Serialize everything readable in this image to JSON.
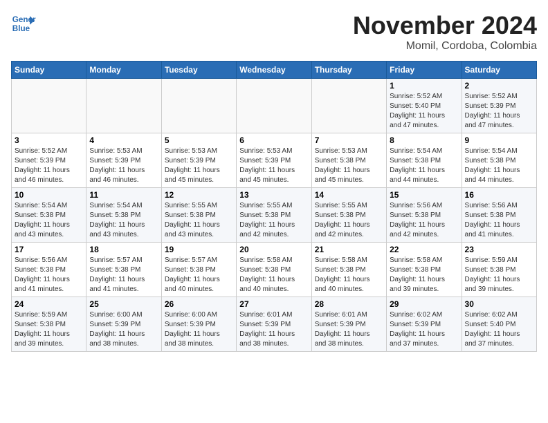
{
  "header": {
    "logo_line1": "General",
    "logo_line2": "Blue",
    "title": "November 2024",
    "subtitle": "Momil, Cordoba, Colombia"
  },
  "calendar": {
    "weekdays": [
      "Sunday",
      "Monday",
      "Tuesday",
      "Wednesday",
      "Thursday",
      "Friday",
      "Saturday"
    ],
    "weeks": [
      [
        {
          "day": "",
          "info": ""
        },
        {
          "day": "",
          "info": ""
        },
        {
          "day": "",
          "info": ""
        },
        {
          "day": "",
          "info": ""
        },
        {
          "day": "",
          "info": ""
        },
        {
          "day": "1",
          "info": "Sunrise: 5:52 AM\nSunset: 5:40 PM\nDaylight: 11 hours\nand 47 minutes."
        },
        {
          "day": "2",
          "info": "Sunrise: 5:52 AM\nSunset: 5:39 PM\nDaylight: 11 hours\nand 47 minutes."
        }
      ],
      [
        {
          "day": "3",
          "info": "Sunrise: 5:52 AM\nSunset: 5:39 PM\nDaylight: 11 hours\nand 46 minutes."
        },
        {
          "day": "4",
          "info": "Sunrise: 5:53 AM\nSunset: 5:39 PM\nDaylight: 11 hours\nand 46 minutes."
        },
        {
          "day": "5",
          "info": "Sunrise: 5:53 AM\nSunset: 5:39 PM\nDaylight: 11 hours\nand 45 minutes."
        },
        {
          "day": "6",
          "info": "Sunrise: 5:53 AM\nSunset: 5:39 PM\nDaylight: 11 hours\nand 45 minutes."
        },
        {
          "day": "7",
          "info": "Sunrise: 5:53 AM\nSunset: 5:38 PM\nDaylight: 11 hours\nand 45 minutes."
        },
        {
          "day": "8",
          "info": "Sunrise: 5:54 AM\nSunset: 5:38 PM\nDaylight: 11 hours\nand 44 minutes."
        },
        {
          "day": "9",
          "info": "Sunrise: 5:54 AM\nSunset: 5:38 PM\nDaylight: 11 hours\nand 44 minutes."
        }
      ],
      [
        {
          "day": "10",
          "info": "Sunrise: 5:54 AM\nSunset: 5:38 PM\nDaylight: 11 hours\nand 43 minutes."
        },
        {
          "day": "11",
          "info": "Sunrise: 5:54 AM\nSunset: 5:38 PM\nDaylight: 11 hours\nand 43 minutes."
        },
        {
          "day": "12",
          "info": "Sunrise: 5:55 AM\nSunset: 5:38 PM\nDaylight: 11 hours\nand 43 minutes."
        },
        {
          "day": "13",
          "info": "Sunrise: 5:55 AM\nSunset: 5:38 PM\nDaylight: 11 hours\nand 42 minutes."
        },
        {
          "day": "14",
          "info": "Sunrise: 5:55 AM\nSunset: 5:38 PM\nDaylight: 11 hours\nand 42 minutes."
        },
        {
          "day": "15",
          "info": "Sunrise: 5:56 AM\nSunset: 5:38 PM\nDaylight: 11 hours\nand 42 minutes."
        },
        {
          "day": "16",
          "info": "Sunrise: 5:56 AM\nSunset: 5:38 PM\nDaylight: 11 hours\nand 41 minutes."
        }
      ],
      [
        {
          "day": "17",
          "info": "Sunrise: 5:56 AM\nSunset: 5:38 PM\nDaylight: 11 hours\nand 41 minutes."
        },
        {
          "day": "18",
          "info": "Sunrise: 5:57 AM\nSunset: 5:38 PM\nDaylight: 11 hours\nand 41 minutes."
        },
        {
          "day": "19",
          "info": "Sunrise: 5:57 AM\nSunset: 5:38 PM\nDaylight: 11 hours\nand 40 minutes."
        },
        {
          "day": "20",
          "info": "Sunrise: 5:58 AM\nSunset: 5:38 PM\nDaylight: 11 hours\nand 40 minutes."
        },
        {
          "day": "21",
          "info": "Sunrise: 5:58 AM\nSunset: 5:38 PM\nDaylight: 11 hours\nand 40 minutes."
        },
        {
          "day": "22",
          "info": "Sunrise: 5:58 AM\nSunset: 5:38 PM\nDaylight: 11 hours\nand 39 minutes."
        },
        {
          "day": "23",
          "info": "Sunrise: 5:59 AM\nSunset: 5:38 PM\nDaylight: 11 hours\nand 39 minutes."
        }
      ],
      [
        {
          "day": "24",
          "info": "Sunrise: 5:59 AM\nSunset: 5:38 PM\nDaylight: 11 hours\nand 39 minutes."
        },
        {
          "day": "25",
          "info": "Sunrise: 6:00 AM\nSunset: 5:39 PM\nDaylight: 11 hours\nand 38 minutes."
        },
        {
          "day": "26",
          "info": "Sunrise: 6:00 AM\nSunset: 5:39 PM\nDaylight: 11 hours\nand 38 minutes."
        },
        {
          "day": "27",
          "info": "Sunrise: 6:01 AM\nSunset: 5:39 PM\nDaylight: 11 hours\nand 38 minutes."
        },
        {
          "day": "28",
          "info": "Sunrise: 6:01 AM\nSunset: 5:39 PM\nDaylight: 11 hours\nand 38 minutes."
        },
        {
          "day": "29",
          "info": "Sunrise: 6:02 AM\nSunset: 5:39 PM\nDaylight: 11 hours\nand 37 minutes."
        },
        {
          "day": "30",
          "info": "Sunrise: 6:02 AM\nSunset: 5:40 PM\nDaylight: 11 hours\nand 37 minutes."
        }
      ]
    ]
  }
}
